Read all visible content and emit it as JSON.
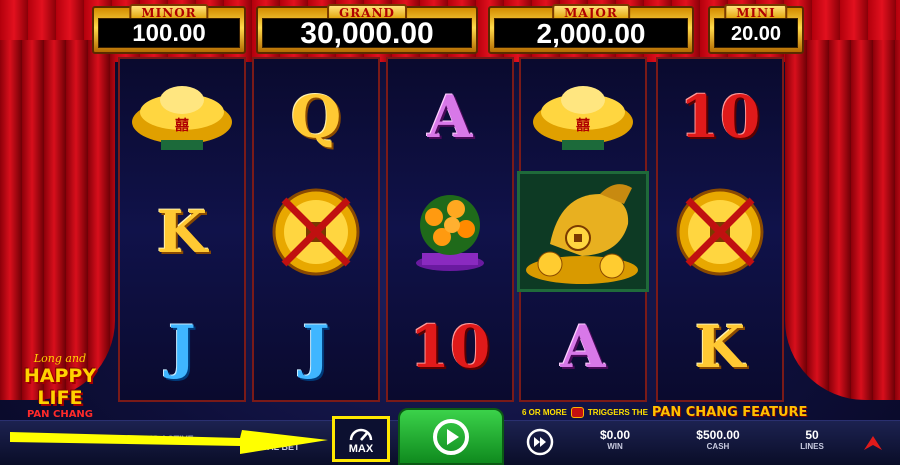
{
  "jackpots": {
    "minor": {
      "label": "MINOR",
      "value": "100.00"
    },
    "grand": {
      "label": "GRAND",
      "value": "30,000.00"
    },
    "major": {
      "label": "MAJOR",
      "value": "2,000.00"
    },
    "mini": {
      "label": "MINI",
      "value": "20.00"
    }
  },
  "reels": [
    [
      "gold-ingot",
      "K",
      "J"
    ],
    [
      "Q",
      "gold-coin",
      "J"
    ],
    [
      "A",
      "orange-tree",
      "10"
    ],
    [
      "gold-ingot",
      "dragon-fortune",
      "A"
    ],
    [
      "10",
      "gold-coin",
      "K"
    ]
  ],
  "logo": {
    "top": "Long and",
    "main": "HAPPY LIFE",
    "sub": "PAN CHANG"
  },
  "trigger": {
    "prefix": "6 OR MORE",
    "middle": "TRIGGERS THE",
    "feature": "PAN CHANG FEATURE"
  },
  "bottom_bar": {
    "left_text": "ARE DONE IS ACTIVE",
    "bet_caption": "TOTAL BET",
    "max_label": "MAX",
    "win": {
      "value": "$0.00",
      "label": "WIN"
    },
    "cash": {
      "value": "$500.00",
      "label": "CASH"
    },
    "lines": {
      "value": "50",
      "label": "LINES"
    }
  },
  "colors": {
    "highlight_box": "#ffe800",
    "spin_button": "#1fa82e",
    "curtain": "#d80f1c"
  },
  "icons": [
    "max-bet-gauge-icon",
    "spin-play-icon",
    "autoplay-fast-forward-icon",
    "menu-arrow-icon"
  ]
}
